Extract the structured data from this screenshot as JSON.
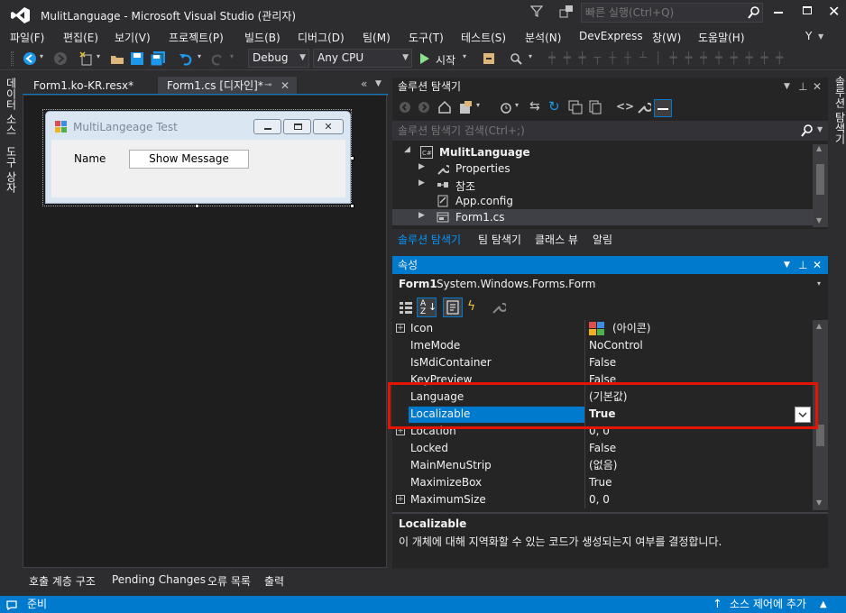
{
  "window": {
    "title": "MulitLanguage - Microsoft Visual Studio  (관리자)",
    "quick_launch_placeholder": "빠른 실행(Ctrl+Q)"
  },
  "menu": [
    "파일(F)",
    "편집(E)",
    "보기(V)",
    "프로젝트(P)",
    "빌드(B)",
    "디버그(D)",
    "팀(M)",
    "도구(T)",
    "테스트(S)",
    "분석(N)",
    "DevExpress",
    "창(W)",
    "도움말(H)"
  ],
  "menu_user_initial": "Y",
  "toolbar": {
    "config": "Debug",
    "platform": "Any CPU",
    "start_label": "시작"
  },
  "left_tabs": [
    "데이터 소스",
    "도구 상자"
  ],
  "right_tabs": [
    "솔루션 탐색기"
  ],
  "editor": {
    "tabs": [
      {
        "label": "Form1.ko-KR.resx*",
        "active": false
      },
      {
        "label": "Form1.cs [디자인]*",
        "active": true
      }
    ],
    "form": {
      "title": "MultiLangeage Test",
      "name_label": "Name",
      "button_label": "Show Message"
    }
  },
  "solution_explorer": {
    "title": "솔루션 탐색기",
    "search_placeholder": "솔루션 탐색기 검색(Ctrl+;)",
    "tree": [
      {
        "label": "MulitLanguage",
        "icon": "csharp-project-icon",
        "bold": true
      },
      {
        "label": "Properties",
        "icon": "wrench-icon"
      },
      {
        "label": "참조",
        "icon": "references-icon"
      },
      {
        "label": "App.config",
        "icon": "config-icon"
      },
      {
        "label": "Form1.cs",
        "icon": "form-icon"
      }
    ],
    "tabs": [
      "솔루션 탐색기",
      "팀 탐색기",
      "클래스 뷰",
      "알림"
    ]
  },
  "properties": {
    "title": "속성",
    "object_name": "Form1",
    "object_type": "System.Windows.Forms.Form",
    "rows": [
      {
        "name": "Icon",
        "value": "(아이콘)",
        "expandable": true
      },
      {
        "name": "ImeMode",
        "value": "NoControl",
        "expandable": false
      },
      {
        "name": "IsMdiContainer",
        "value": "False",
        "expandable": false
      },
      {
        "name": "KeyPreview",
        "value": "False",
        "expandable": false
      },
      {
        "name": "Language",
        "value": "(기본값)",
        "expandable": false
      },
      {
        "name": "Localizable",
        "value": "True",
        "expandable": false
      },
      {
        "name": "Location",
        "value": "0, 0",
        "expandable": true
      },
      {
        "name": "Locked",
        "value": "False",
        "expandable": false
      },
      {
        "name": "MainMenuStrip",
        "value": "(없음)",
        "expandable": false
      },
      {
        "name": "MaximizeBox",
        "value": "True",
        "expandable": false
      },
      {
        "name": "MaximumSize",
        "value": "0, 0",
        "expandable": true
      }
    ],
    "selected_row": "Localizable",
    "description_title": "Localizable",
    "description_text": "이 개체에 대해 지역화할 수 있는 코드가 생성되는지 여부를 결정합니다."
  },
  "bottom_tabs": [
    "호출 계층 구조",
    "Pending Changes",
    "오류 목록",
    "출력"
  ],
  "status": {
    "left": "준비",
    "right": "소스 제어에 추가"
  },
  "colors": {
    "accent": "#007acc",
    "highlight_box": "#e51400",
    "background": "#2d2d30",
    "panel": "#252526"
  }
}
